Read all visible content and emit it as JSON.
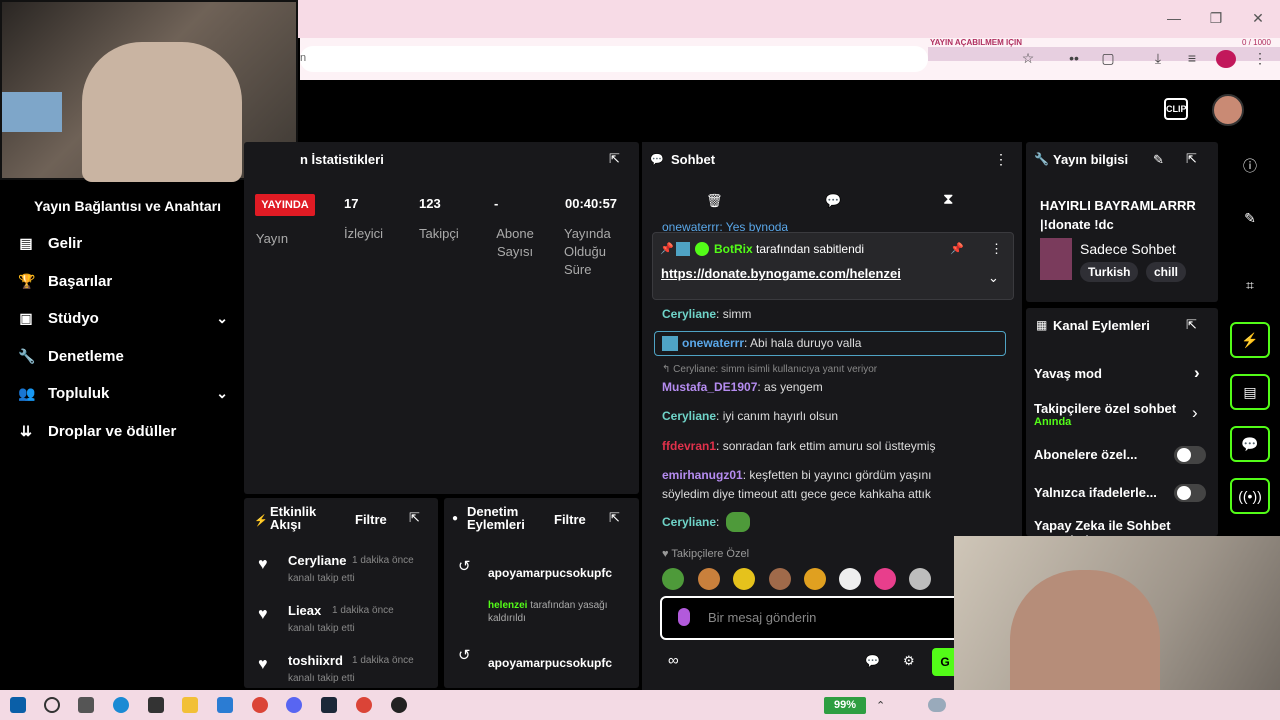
{
  "browser": {
    "overlay_title": "YAYIN AÇABILMEM IÇIN",
    "overlay_count": "0 / 1000",
    "address_suffix": "n"
  },
  "header": {
    "clip_label": "CLIP"
  },
  "sidebar": {
    "title": "Yayın Bağlantısı ve Anahtarı",
    "items": [
      {
        "label": "Gelir",
        "icon": "revenue-icon"
      },
      {
        "label": "Başarılar",
        "icon": "trophy-icon"
      },
      {
        "label": "Stüdyo",
        "icon": "studio-icon"
      },
      {
        "label": "Denetleme",
        "icon": "wrench-icon"
      },
      {
        "label": "Topluluk",
        "icon": "community-icon"
      },
      {
        "label": "Droplar ve ödüller",
        "icon": "drops-icon"
      }
    ]
  },
  "stats": {
    "title": "n İstatistikleri",
    "live_badge": "YAYINDA",
    "status_label": "Yayın",
    "viewers": "17",
    "viewers_label": "İzleyici",
    "followers": "123",
    "followers_label": "Takipçi",
    "subs": "-",
    "subs_label": "Abone Sayısı",
    "uptime": "00:40:57",
    "uptime_label": "Yayında Olduğu Süre"
  },
  "activity": {
    "title": "Etkinlik Akışı",
    "filter": "Filtre",
    "rows": [
      {
        "name": "Ceryliane",
        "time": "1 dakika önce",
        "sub": "kanalı takip etti"
      },
      {
        "name": "Lieax",
        "time": "1 dakika önce",
        "sub": "kanalı takip etti"
      },
      {
        "name": "toshiixrd",
        "time": "1 dakika önce",
        "sub": "kanalı takip etti"
      }
    ]
  },
  "modlog": {
    "title": "Denetim Eylemleri",
    "filter": "Filtre",
    "rows": [
      {
        "name": "apoyamarpucsokupfc"
      },
      {
        "actor": "helenzei",
        "text": "tarafından yasağı kaldırıldı"
      },
      {
        "name": "apoyamarpucsokupfc"
      }
    ]
  },
  "chat": {
    "title": "Sohbet",
    "cut_msg": "onewaterrr: Yes bynoda",
    "pinned_by": "BotRix",
    "pinned_suffix": "tarafından sabitlendi",
    "pinned_link": "https://donate.bynogame.com/helenzei",
    "messages": [
      {
        "name": "Ceryliane",
        "color": "#6fd3c8",
        "text": ": simm"
      },
      {
        "name": "onewaterrr",
        "color": "#5aa7e8",
        "text": ": Abi hala duruyo valla"
      },
      {
        "reply": "Ceryliane: simm isimli kullanıcıya yanıt veriyor"
      },
      {
        "name": "Mustafa_DE1907",
        "color": "#b58cf0",
        "text": ": as yengem"
      },
      {
        "name": "Ceryliane",
        "color": "#6fd3c8",
        "text": ": iyi canım hayırlı olsun"
      },
      {
        "name": "ffdevran1",
        "color": "#e0314b",
        "text": ": sonradan fark ettim amuru sol üstteymiş"
      },
      {
        "name": "emirhanugz01",
        "color": "#b58cf0",
        "text": ": keşfetten bi yayıncı gördüm yaşını"
      },
      {
        "text2": "söyledim diye timeout attı gece gece kahkaha attık"
      },
      {
        "name": "Ceryliane",
        "color": "#6fd3c8",
        "text": ":"
      }
    ],
    "followers_only": "Takipçilere Özel",
    "placeholder": "Bir mesaj gönderin",
    "send_label": "G"
  },
  "info": {
    "title": "Yayın bilgisi",
    "stream_title": "HAYIRLI BAYRAMLARRR |!donate !dc",
    "category": "Sadece Sohbet",
    "tags": [
      "Turkish",
      "chill"
    ]
  },
  "actions": {
    "title": "Kanal Eylemleri",
    "slow": "Yavaş mod",
    "followers": "Takipçilere özel sohbet",
    "followers_sub": "Anında",
    "subs": "Abonelere özel...",
    "emotes": "Yalnızca ifadelerle...",
    "ai": "Yapay Zeka ile Sohbet Denetimi"
  },
  "taskbar": {
    "battery": "99%"
  },
  "colors": {
    "accent": "#53fc18",
    "live": "#e01b24",
    "panel": "#18181b"
  }
}
